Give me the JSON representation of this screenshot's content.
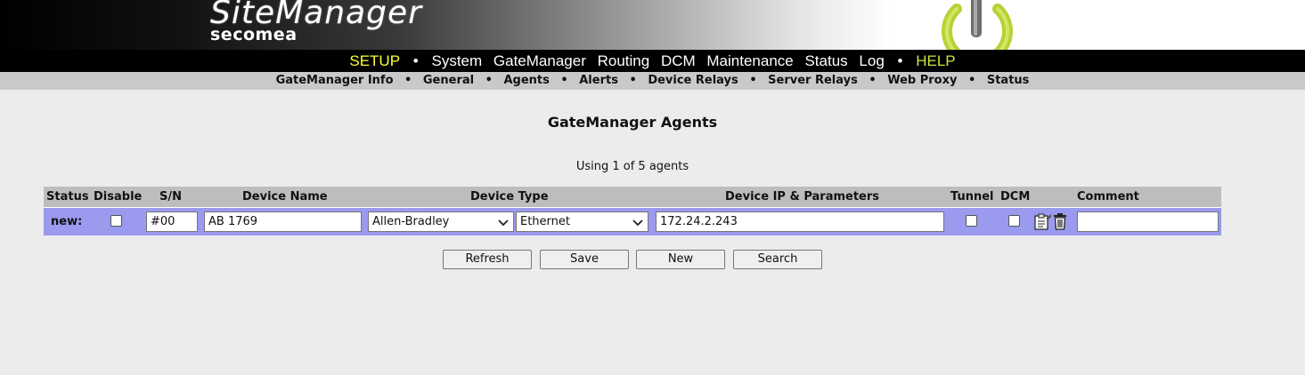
{
  "brand": {
    "title": "SiteManager",
    "subtitle": "secomea"
  },
  "mainnav": {
    "setup": "SETUP",
    "system": "System",
    "gatemanager": "GateManager",
    "routing": "Routing",
    "dcm": "DCM",
    "maintenance": "Maintenance",
    "status": "Status",
    "log": "Log",
    "help": "HELP",
    "separator": "•"
  },
  "subnav": {
    "items": [
      "GateManager Info",
      "General",
      "Agents",
      "Alerts",
      "Device Relays",
      "Server Relays",
      "Web Proxy",
      "Status"
    ],
    "separator": "•"
  },
  "page": {
    "title": "GateManager Agents",
    "usage": "Using 1 of 5 agents"
  },
  "table": {
    "headers": {
      "status": "Status",
      "disable": "Disable",
      "sn": "S/N",
      "device_name": "Device Name",
      "device_type": "Device Type",
      "device_ip": "Device IP & Parameters",
      "tunnel": "Tunnel",
      "dcm": "DCM",
      "comment": "Comment"
    },
    "row": {
      "status": "new:",
      "disable_checked": false,
      "sn": "#00",
      "device_name": "AB 1769",
      "device_vendor": "Allen-Bradley",
      "device_interface": "Ethernet",
      "device_ip": "172.24.2.243",
      "tunnel_checked": false,
      "dcm_checked": false,
      "comment": "",
      "icons": [
        "properties-icon",
        "trash-icon"
      ]
    }
  },
  "buttons": {
    "refresh": "Refresh",
    "save": "Save",
    "new": "New",
    "search": "Search"
  },
  "colors": {
    "nav_active": "#ffff33",
    "nav_help": "#c8e640",
    "row_bg": "#9a9aef",
    "header_bg": "#bdbdbd",
    "logo_green": "#b5d334"
  }
}
